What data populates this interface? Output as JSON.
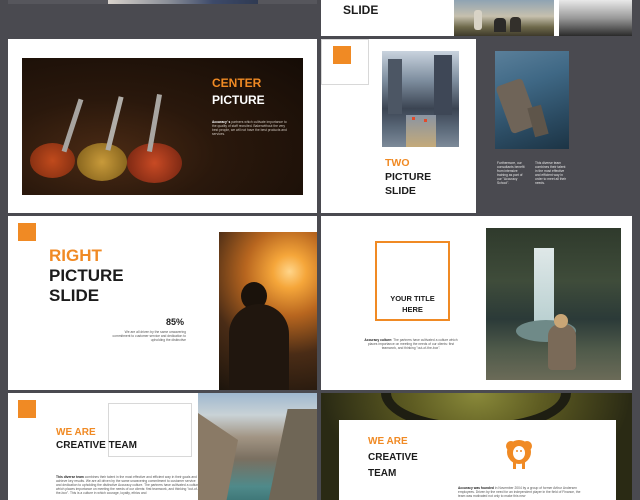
{
  "slides": {
    "top_left": {},
    "top_right": {
      "title": "SLIDE"
    },
    "center_picture": {
      "title_line1": "CENTER",
      "title_line2": "PICTURE",
      "body_bold": "Accuracy' s",
      "body": "partners which cultivate importance to the quality of staff recruited. Bakerwithout the very best people, we will not have the best products and services."
    },
    "two_picture": {
      "title_line1": "TWO",
      "title_line2": "PICTURE",
      "title_line3": "SLIDE",
      "col1": "Furthermore, our consultants benefit from intensive training as part of our \"Accuracy School\".",
      "col2": "This diverse team combines their talent in the most effective and efficient way in order to meet all their needs."
    },
    "right_picture": {
      "title_line1": "RIGHT",
      "title_line2": "PICTURE",
      "title_line3": "SLIDE",
      "percent": "85%",
      "body": "We are all driven by the same unwavering commitment to customer service and dedication to upholding the distinctive"
    },
    "your_title": {
      "title_line1": "YOUR TITLE",
      "title_line2": "HERE",
      "body_bold": "Accuracy culture:",
      "body": "The partners have cultivated a culture which places importance on meeting the needs of our clients: first teamwork, and thinking \"out-of-the-box\"."
    },
    "creative_team_left": {
      "title_line1": "WE ARE",
      "title_line2": "CREATIVE TEAM",
      "body_bold": "This diverse team",
      "body": "combines their talent in the most effective and efficient way in their goals and achieve key results. We are all driven by the same unwavering commitment to customer service and dedication to upholding the distinctive Accuracy culture. The partners have cultivated a culture which places importance on meeting the needs of our clients: first teamwork, and thinking \"out-of-the-box\". This is a culture in which courage, loyalty, ethics and"
    },
    "creative_team_right": {
      "title_line1": "WE ARE",
      "title_line2": "CREATIVE",
      "title_line3": "TEAM",
      "icon": "sheep-icon",
      "body_bold": "Accuracy was founded",
      "body": "in November 2004 by a group of former Arthur Andersen employees. Driven by the need for an independent player in the field of Finance, the team was motivated not only to make this new"
    }
  },
  "colors": {
    "accent": "#f08a24",
    "background": "#4a4a50",
    "text": "#1c1c1c"
  }
}
